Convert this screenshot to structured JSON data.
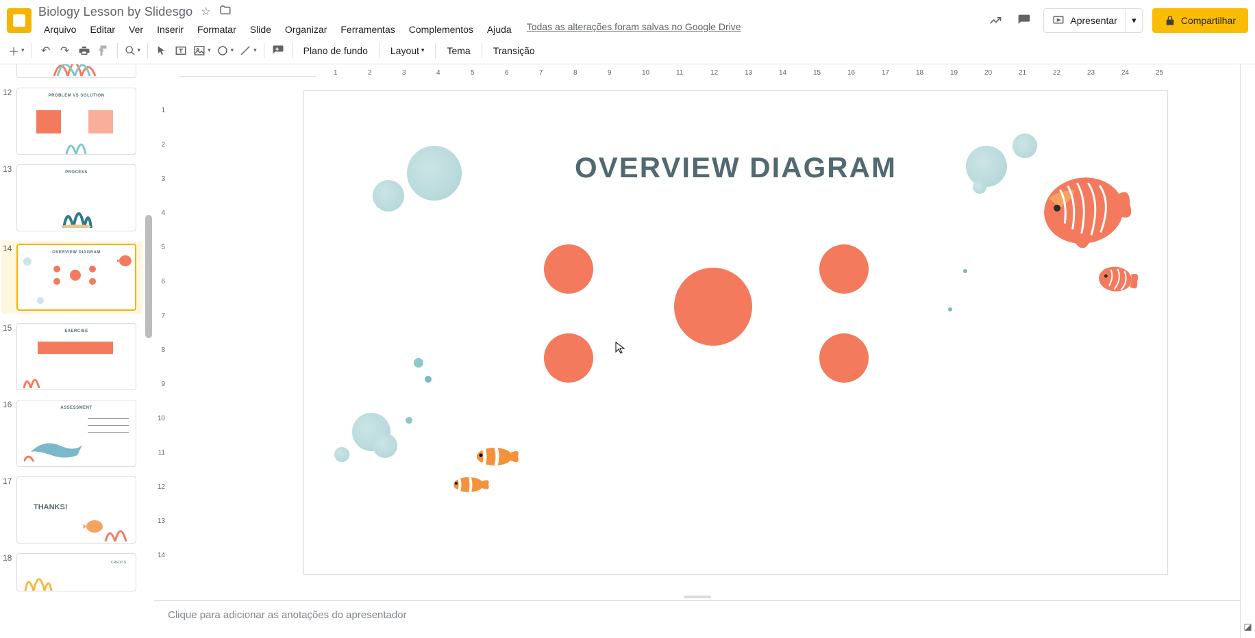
{
  "doc": {
    "title": "Biology Lesson by Slidesgo"
  },
  "menu": {
    "file": "Arquivo",
    "edit": "Editar",
    "view": "Ver",
    "insert": "Inserir",
    "format": "Formatar",
    "slide": "Slide",
    "arrange": "Organizar",
    "tools": "Ferramentas",
    "addons": "Complementos",
    "help": "Ajuda",
    "save_status": "Todas as alterações foram salvas no Google Drive"
  },
  "actions": {
    "present": "Apresentar",
    "share": "Compartilhar"
  },
  "toolbar": {
    "background": "Plano de fundo",
    "layout": "Layout",
    "theme": "Tema",
    "transition": "Transição"
  },
  "slide": {
    "title": "OVERVIEW DIAGRAM"
  },
  "thumbs": {
    "t12": "PROBLEM VS SOLUTION",
    "t13": "PROCESS",
    "t14": "OVERVIEW DIAGRAM",
    "t15": "EXERCISE",
    "t16": "ASSESSMENT",
    "t17": "THANKS!",
    "t18": "CREDITS",
    "n12": "12",
    "n13": "13",
    "n14": "14",
    "n15": "15",
    "n16": "16",
    "n17": "17",
    "n18": "18"
  },
  "ruler_h": [
    "1",
    "2",
    "3",
    "4",
    "5",
    "6",
    "7",
    "8",
    "9",
    "10",
    "11",
    "12",
    "13",
    "14",
    "15",
    "16",
    "17",
    "18",
    "19",
    "20",
    "21",
    "22",
    "23",
    "24",
    "25"
  ],
  "ruler_v": [
    "1",
    "2",
    "3",
    "4",
    "5",
    "6",
    "7",
    "8",
    "9",
    "10",
    "11",
    "12",
    "13",
    "14"
  ],
  "notes": {
    "placeholder": "Clique para adicionar as anotações do apresentador"
  }
}
